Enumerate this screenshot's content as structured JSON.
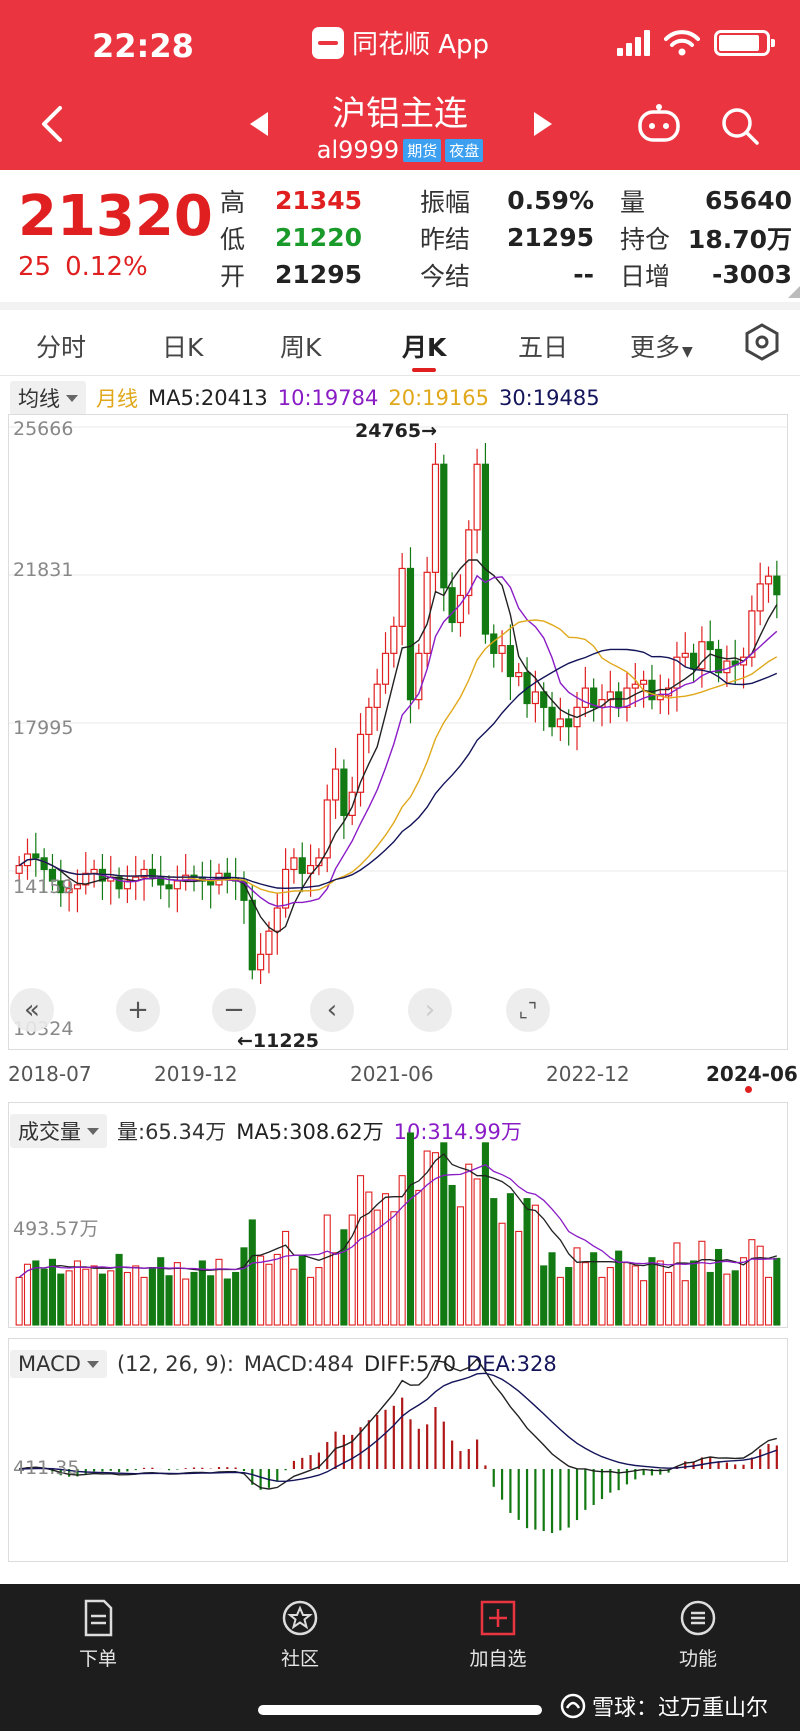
{
  "status_bar": {
    "time": "22:28",
    "app_name": "同花顺 App"
  },
  "header": {
    "title": "沪铝主连",
    "code": "al9999",
    "badges": [
      "期货",
      "夜盘"
    ]
  },
  "quote": {
    "price": "21320",
    "change": "25",
    "change_pct": "0.12%",
    "cols": [
      [
        {
          "label": "高",
          "value": "21345",
          "color": "red"
        },
        {
          "label": "低",
          "value": "21220",
          "color": "green"
        },
        {
          "label": "开",
          "value": "21295",
          "color": "black"
        }
      ],
      [
        {
          "label": "振幅",
          "value": "0.59%",
          "color": "black"
        },
        {
          "label": "昨结",
          "value": "21295",
          "color": "black"
        },
        {
          "label": "今结",
          "value": "--",
          "color": "black"
        }
      ],
      [
        {
          "label": "量",
          "value": "65640",
          "color": "black"
        },
        {
          "label": "持仓",
          "value": "18.70万",
          "color": "black"
        },
        {
          "label": "日增",
          "value": "-3003",
          "color": "black"
        }
      ]
    ]
  },
  "tabs": [
    "分时",
    "日K",
    "周K",
    "月K",
    "五日",
    "更多"
  ],
  "active_tab": "月K",
  "ma_row": {
    "selector": "均线",
    "period": "月线",
    "ma5": "MA5:20413",
    "ma10": "10:19784",
    "ma20": "20:19165",
    "ma30": "30:19485"
  },
  "kline_axis": {
    "y_labels": [
      "25666",
      "21831",
      "17995",
      "14159",
      "10324"
    ],
    "high_label": "24765→",
    "low_label": "←11225",
    "x_labels": [
      "2018-07",
      "2019-12",
      "2021-06",
      "2022-12",
      "2024-06"
    ]
  },
  "vol_row": {
    "selector": "成交量",
    "vol": "量:65.34万",
    "ma5": "MA5:308.62万",
    "ma10": "10:314.99万",
    "y_label": "493.57万"
  },
  "macd_row": {
    "selector": "MACD",
    "params": "(12, 26, 9):",
    "macd": "MACD:484",
    "diff": "DIFF:570",
    "dea": "DEA:328",
    "y_label": "411.35"
  },
  "chart_data": {
    "type": "candlestick",
    "x_range": [
      "2018-07",
      "2024-06"
    ],
    "ylim": [
      10324,
      25666
    ],
    "close": [
      14300,
      14600,
      14500,
      14200,
      13900,
      13600,
      13700,
      13800,
      14100,
      14200,
      13900,
      14000,
      13700,
      13900,
      14000,
      14200,
      14000,
      13800,
      13700,
      13900,
      14050,
      14000,
      13900,
      13800,
      14100,
      13950,
      13900,
      13400,
      11600,
      12000,
      12600,
      13200,
      14200,
      14500,
      14100,
      14300,
      14500,
      16000,
      16800,
      15600,
      16200,
      17700,
      18400,
      19000,
      19800,
      20500,
      22000,
      18600,
      19800,
      21900,
      24700,
      21500,
      20600,
      21300,
      23000,
      24700,
      20300,
      19800,
      20000,
      19200,
      19300,
      18500,
      18800,
      18400,
      17900,
      18100,
      17900,
      18400,
      18900,
      18400,
      18600,
      18800,
      18400,
      18900,
      19000,
      19100,
      18600,
      18700,
      18900,
      19700,
      19800,
      19400,
      20100,
      19900,
      19300,
      19600,
      19500,
      19700,
      20900,
      21600,
      21800,
      21320
    ],
    "colors": {
      "up": "#e02020",
      "down": "#137a13",
      "ma5": "#222222",
      "ma10": "#8a1cc6",
      "ma20": "#e0a81a",
      "ma30": "#14145a"
    }
  },
  "bottom_nav": [
    "下单",
    "社区",
    "加自选",
    "功能"
  ],
  "watermark": "雪球：过万重山尔"
}
